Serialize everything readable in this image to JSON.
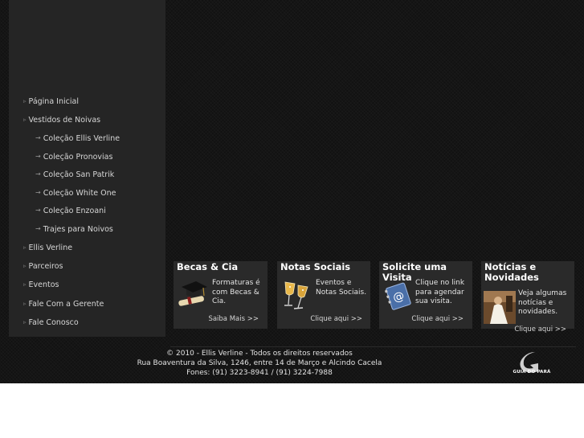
{
  "nav": {
    "items": [
      {
        "label": "Página Inicial"
      },
      {
        "label": "Vestidos de Noivas"
      },
      {
        "label": "Coleção Ellis Verline"
      },
      {
        "label": "Coleção Pronovias"
      },
      {
        "label": "Coleção San Patrik"
      },
      {
        "label": "Coleção White One"
      },
      {
        "label": "Coleção Enzoani"
      },
      {
        "label": "Trajes para Noivos"
      },
      {
        "label": "Ellis Verline"
      },
      {
        "label": "Parceiros"
      },
      {
        "label": "Eventos"
      },
      {
        "label": "Fale Com a Gerente"
      },
      {
        "label": "Fale Conosco"
      }
    ]
  },
  "boxes": [
    {
      "title": "Becas & Cia",
      "text": "Formaturas é com Becas & Cia.",
      "link": "Saiba Mais >>"
    },
    {
      "title": "Notas Sociais",
      "text": "Eventos e Notas Sociais.",
      "link": "Clique aqui >>"
    },
    {
      "title": "Solicite uma Visita",
      "text": "Clique no link para agendar sua visita.",
      "link": "Clique aqui >>"
    },
    {
      "title": "Notícias e Novidades",
      "text": "Veja algumas notícias e novidades.",
      "link": "Clique aqui >>"
    }
  ],
  "footer": {
    "copyright": "© 2010 - Ellis Verline - Todos os direitos reservados",
    "address": "Rua Boaventura da Silva, 1246, entre 14 de Março e Alcindo Cacela",
    "phones": "Fones: (91) 3223-8941 / (91) 3224-7988",
    "partner_logo": "GUIA DO PARÁ"
  },
  "icons": {
    "main_bullet": "triangle-right-icon",
    "sub_bullet": "arrow-right-icon"
  }
}
